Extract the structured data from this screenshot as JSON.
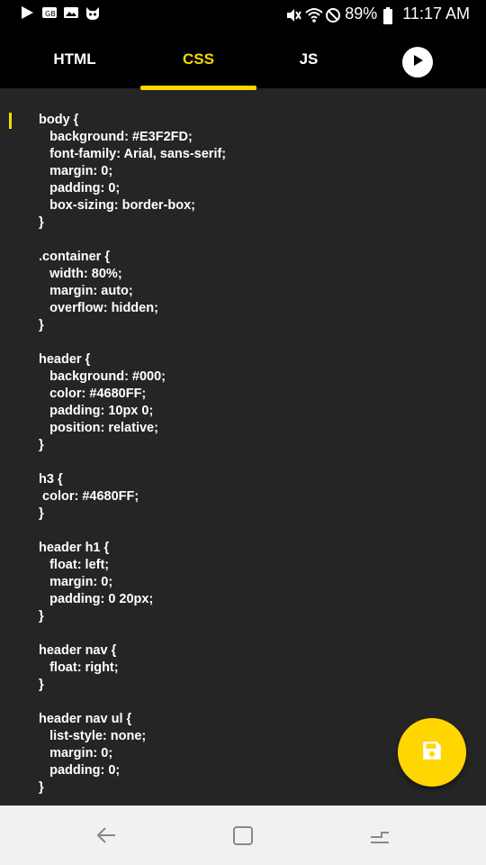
{
  "status_bar": {
    "battery": "89%",
    "time": "11:17 AM",
    "left_icons": [
      "play-store-icon",
      "notification-icon",
      "image-icon",
      "mascot-icon"
    ],
    "right_icons": [
      "mute-icon",
      "wifi-icon",
      "do-not-disturb-icon",
      "battery-icon"
    ]
  },
  "tabs": [
    {
      "label": "HTML",
      "active": false
    },
    {
      "label": "CSS",
      "active": true
    },
    {
      "label": "JS",
      "active": false
    }
  ],
  "colors": {
    "accent": "#F8D800",
    "fab": "#FFD600",
    "editor_bg": "#252525"
  },
  "code_lines": [
    "body {",
    "   background: #E3F2FD;",
    "   font-family: Arial, sans-serif;",
    "   margin: 0;",
    "   padding: 0;",
    "   box-sizing: border-box;",
    "}",
    "",
    ".container {",
    "   width: 80%;",
    "   margin: auto;",
    "   overflow: hidden;",
    "}",
    "",
    "header {",
    "   background: #000;",
    "   color: #4680FF;",
    "   padding: 10px 0;",
    "   position: relative;",
    "}",
    "",
    "h3 {",
    " color: #4680FF;",
    "}",
    "",
    "header h1 {",
    "   float: left;",
    "   margin: 0;",
    "   padding: 0 20px;",
    "}",
    "",
    "header nav {",
    "   float: right;",
    "}",
    "",
    "header nav ul {",
    "   list-style: none;",
    "   margin: 0;",
    "   padding: 0;",
    "}"
  ]
}
